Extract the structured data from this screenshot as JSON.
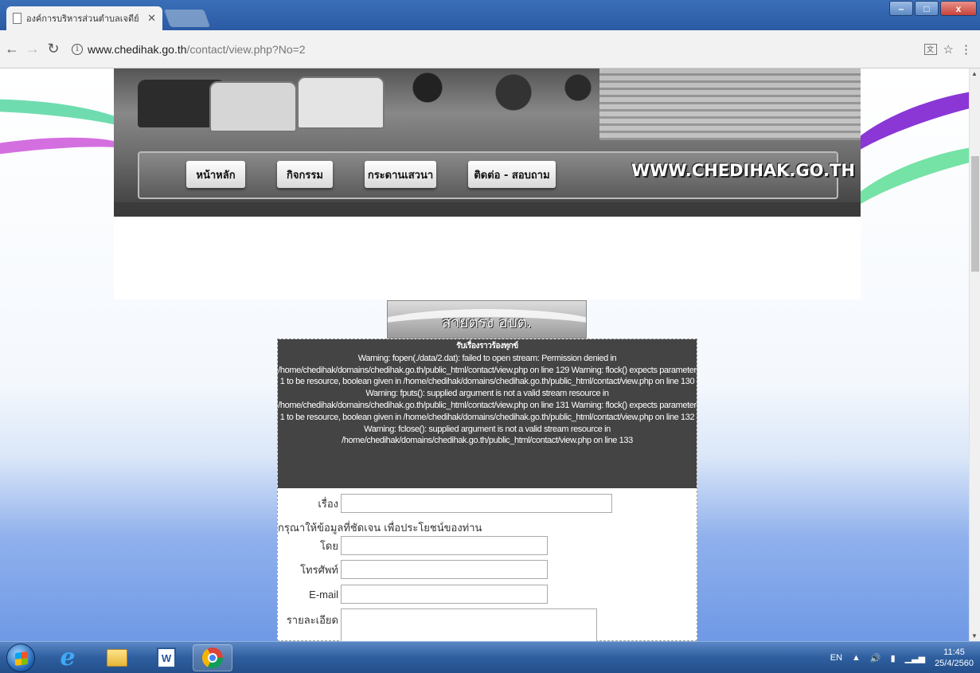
{
  "browser": {
    "tab_title": "องค์การบริหารส่วนตำบลเจดีย์",
    "tab_close": "✕",
    "url_host": "www.chedihak.go.th",
    "url_path": "/contact/view.php?No=2",
    "window_min": "–",
    "window_max": "□",
    "window_close": "x"
  },
  "banner": {
    "menu": [
      {
        "label": "หน้าหลัก"
      },
      {
        "label": "กิจกรรม"
      },
      {
        "label": "กระดานเสวนา"
      },
      {
        "label": "ติดต่อ - สอบถาม"
      }
    ],
    "site_name": "WWW.CHEDIHAK.GO.TH"
  },
  "hotline": {
    "label": "สายตรง อบต."
  },
  "warning": {
    "title": "รับเรื่องราวร้องทุกข์",
    "text": "Warning: fopen(./data/2.dat): failed to open stream: Permission denied in /home/chedihak/domains/chedihak.go.th/public_html/contact/view.php on line 129 Warning: flock() expects parameter 1 to be resource, boolean given in /home/chedihak/domains/chedihak.go.th/public_html/contact/view.php on line 130 Warning: fputs(): supplied argument is not a valid stream resource in /home/chedihak/domains/chedihak.go.th/public_html/contact/view.php on line 131 Warning: flock() expects parameter 1 to be resource, boolean given in /home/chedihak/domains/chedihak.go.th/public_html/contact/view.php on line 132 Warning: fclose(): supplied argument is not a valid stream resource in /home/chedihak/domains/chedihak.go.th/public_html/contact/view.php on line 133"
  },
  "form": {
    "subject_label": "เรื่อง",
    "hint": "กรุณาให้ข้อมูลที่ชัดเจน เพื่อประโยชน์ของท่าน",
    "by_label": "โดย",
    "phone_label": "โทรศัพท์",
    "email_label": "E-mail",
    "detail_label": "รายละเอียด"
  },
  "taskbar": {
    "lang": "EN",
    "time": "11:45",
    "date": "25/4/2560"
  }
}
